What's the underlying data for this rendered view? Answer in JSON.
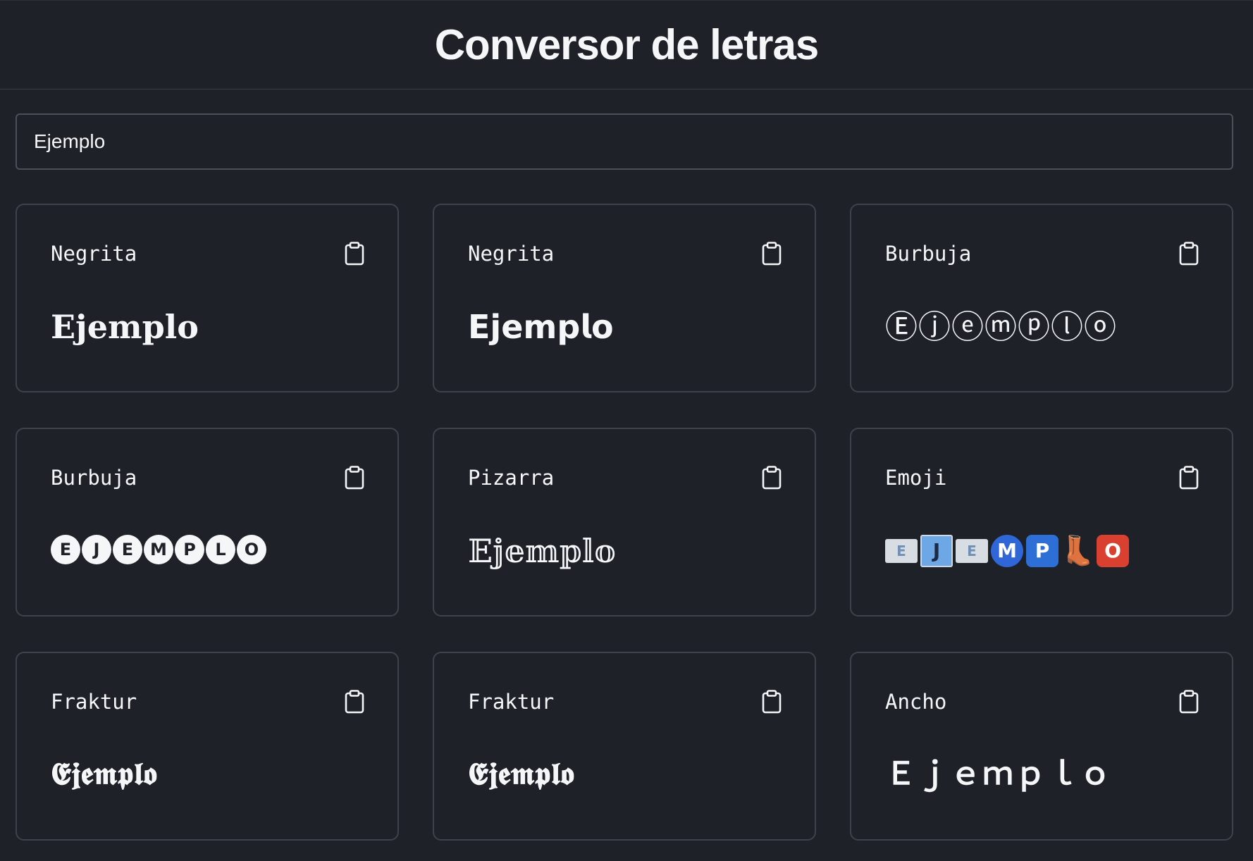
{
  "header": {
    "title": "Conversor de letras"
  },
  "input": {
    "value": "Ejemplo"
  },
  "cards": [
    {
      "label": "Negrita",
      "output": "𝐄𝐣𝐞𝐦𝐩𝐥𝐨"
    },
    {
      "label": "Negrita",
      "output": "𝗘𝗷𝗲𝗺𝗽𝗹𝗼"
    },
    {
      "label": "Burbuja",
      "output": "Ⓔⓙⓔⓜⓟⓛⓞ"
    },
    {
      "label": "Burbuja",
      "letters": [
        "E",
        "J",
        "E",
        "M",
        "P",
        "L",
        "O"
      ]
    },
    {
      "label": "Pizarra",
      "output": "𝔼𝕛𝕖𝕞𝕡𝕝𝕠"
    },
    {
      "label": "Emoji",
      "letters": [
        "E",
        "J",
        "E",
        "M",
        "P",
        "👢",
        "O"
      ]
    },
    {
      "label": "Fraktur",
      "output": "𝕰𝖏𝖊𝖒𝖕𝖑𝖔"
    },
    {
      "label": "Fraktur",
      "output": "𝕰𝖏𝖊𝖒𝖕𝖑𝖔"
    },
    {
      "label": "Ancho",
      "output": "Ｅｊｅｍｐｌｏ"
    }
  ],
  "icons": {
    "copy": "clipboard-icon"
  }
}
